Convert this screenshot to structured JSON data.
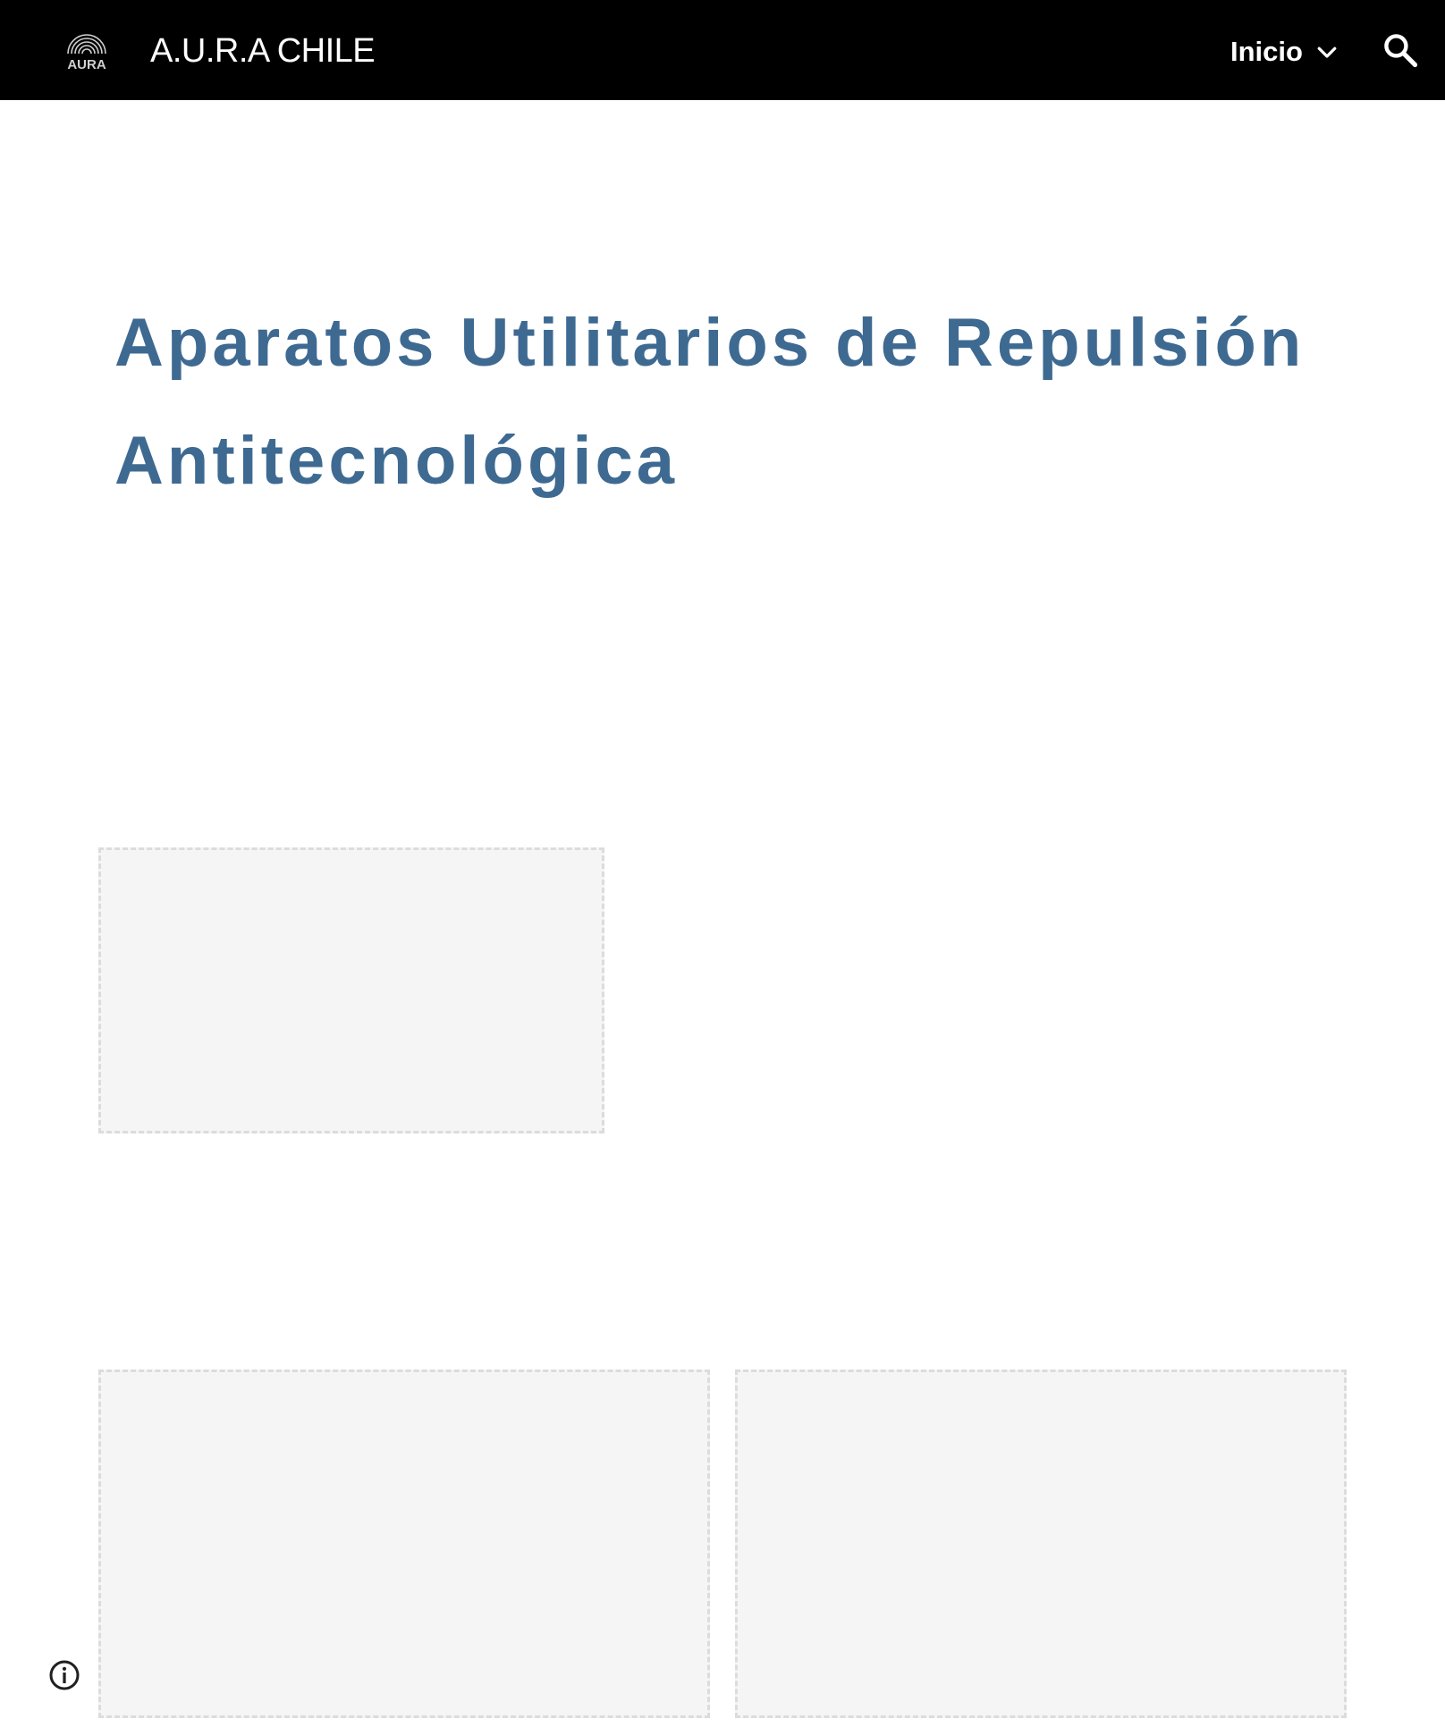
{
  "header": {
    "logo_text": "AURA",
    "site_title": "A.U.R.A CHILE",
    "nav_label": "Inicio",
    "nav_icon": "chevron-down-icon",
    "search_icon": "search-icon"
  },
  "hero": {
    "line1": [
      {
        "cap": "A",
        "rest": "paratos "
      },
      {
        "cap": "U",
        "rest": "tilitarios de "
      },
      {
        "cap": "R",
        "rest": "epulsión"
      }
    ],
    "line2": [
      {
        "cap": "A",
        "rest": "ntitecnológica"
      }
    ]
  },
  "footer": {
    "info_icon": "info-icon"
  },
  "colors": {
    "topbar": "#000000",
    "heading": "#3e6a92",
    "placeholder_fill": "#f5f5f5",
    "placeholder_border": "#dcdcdc"
  }
}
